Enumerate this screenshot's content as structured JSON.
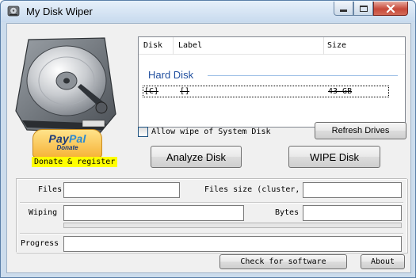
{
  "window": {
    "title": "My Disk Wiper",
    "icon": "hard-disk-icon",
    "controls": [
      "minimize-icon",
      "maximize-icon",
      "close-icon"
    ]
  },
  "donate": {
    "logo_text_1": "Pay",
    "logo_text_2": "Pal",
    "logo_sub": "Donate",
    "label": "Donate & register"
  },
  "disk_list": {
    "columns": [
      "Disk",
      "Label",
      "Size"
    ],
    "group": "Hard Disk",
    "rows": [
      {
        "disk": "[C]",
        "label": "[]",
        "size": "43 GB"
      }
    ]
  },
  "allow_system_wipe": {
    "label": "Allow wipe of System Disk",
    "checked": false
  },
  "buttons": {
    "refresh": "Refresh Drives",
    "analyze": "Analyze Disk",
    "wipe": "WIPE Disk",
    "check": "Check for software",
    "about": "About"
  },
  "stats": {
    "files_label": "Files",
    "files_value": "",
    "files_size_label": "Files size (cluster,",
    "files_size_value": "",
    "wiping_label": "Wiping",
    "wiping_value": "",
    "bytes_label": "Bytes",
    "bytes_value": "",
    "wiping_progress": 0,
    "progress_label": "Progress",
    "progress_value": 0
  },
  "colors": {
    "accent": "#1f4e9e",
    "donate_highlight": "#ffff00",
    "close_button": "#c7493a"
  }
}
